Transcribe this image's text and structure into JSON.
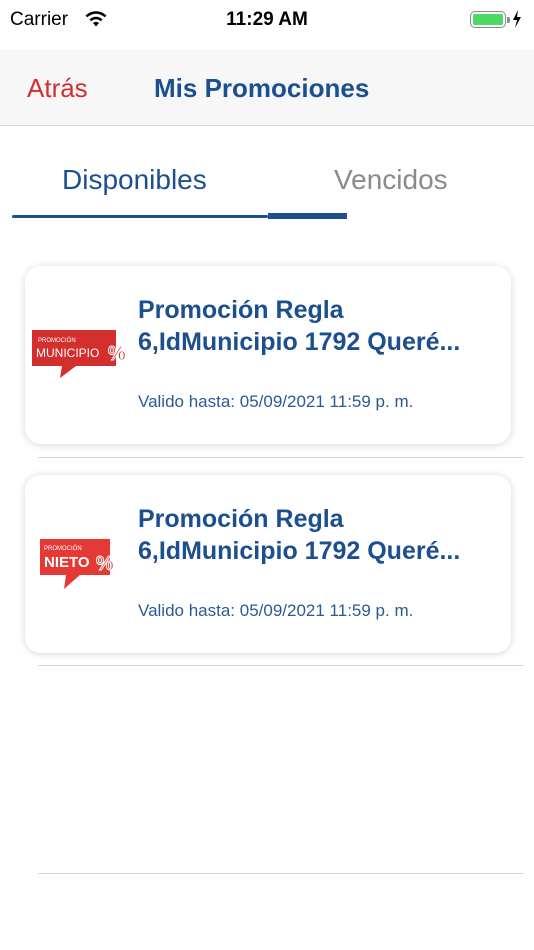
{
  "status_bar": {
    "carrier": "Carrier",
    "time": "11:29 AM",
    "battery_level": 1.0,
    "battery_color": "#4cd964"
  },
  "nav": {
    "back_label": "Atrás",
    "title": "Mis Promociones"
  },
  "tabs": [
    {
      "label": "Disponibles",
      "selected": true
    },
    {
      "label": "Vencidos",
      "selected": false
    }
  ],
  "promotions": [
    {
      "title": "Promoción  Regla\n6,IdMunicipio 1792 Queré...",
      "valid_until": "Valido hasta: 05/09/2021 11:59 p. m.",
      "badge": {
        "top": "PROMOCIÓN",
        "main": "MUNICIPIO",
        "symbol": "%"
      }
    },
    {
      "title": "Promoción  Regla\n6,IdMunicipio 1792 Queré...",
      "valid_until": "Valido hasta: 05/09/2021 11:59 p. m.",
      "badge": {
        "top": "PROMOCIÓN",
        "main": "NIETO",
        "symbol": "%"
      }
    }
  ],
  "colors": {
    "primary": "#1c4f8f",
    "back": "#d32f2f",
    "badge_red": "#d32f2f",
    "inactive_tab": "#8a8a8a"
  },
  "icons": [
    "wifi-icon",
    "battery-icon",
    "charging-bolt-icon",
    "promo-municipio-badge-icon",
    "promo-nieto-badge-icon"
  ]
}
